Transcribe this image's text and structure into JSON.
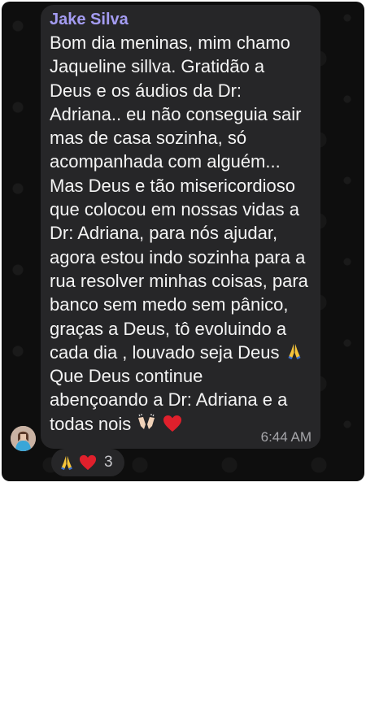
{
  "message": {
    "sender": "Jake Silva",
    "lines": [
      "Bom dia meninas, mim chamo",
      "Jaqueline sillva. Gratidão a",
      "Deus e os áudios da Dr:",
      "Adriana.. eu não conseguia sair",
      "mas de casa sozinha, só",
      "acompanhada com alguém...",
      "Mas Deus e tão misericordioso",
      "que colocou em nossas vidas a",
      "Dr: Adriana, para nós ajudar,",
      "agora estou indo sozinha para a",
      "rua resolver minhas coisas, para",
      "banco sem medo sem pânico,",
      "graças a Deus, tô evoluindo a",
      "cada dia , louvado seja Deus",
      "Que Deus continue",
      "abençoando a Dr: Adriana e a",
      "todas nois"
    ],
    "time": "6:44 AM",
    "inline_icons": [
      "praying-hands-icon",
      "raising-hands-icon",
      "red-heart-icon"
    ]
  },
  "reactions": {
    "icons": [
      "praying-hands-icon",
      "red-heart-icon"
    ],
    "count": "3"
  },
  "colors": {
    "panel_background": "#0e0e0e",
    "bubble": "#262628",
    "sender_name": "#a49cf2",
    "heart": "#e0202c",
    "hands": "#f5c43a"
  }
}
